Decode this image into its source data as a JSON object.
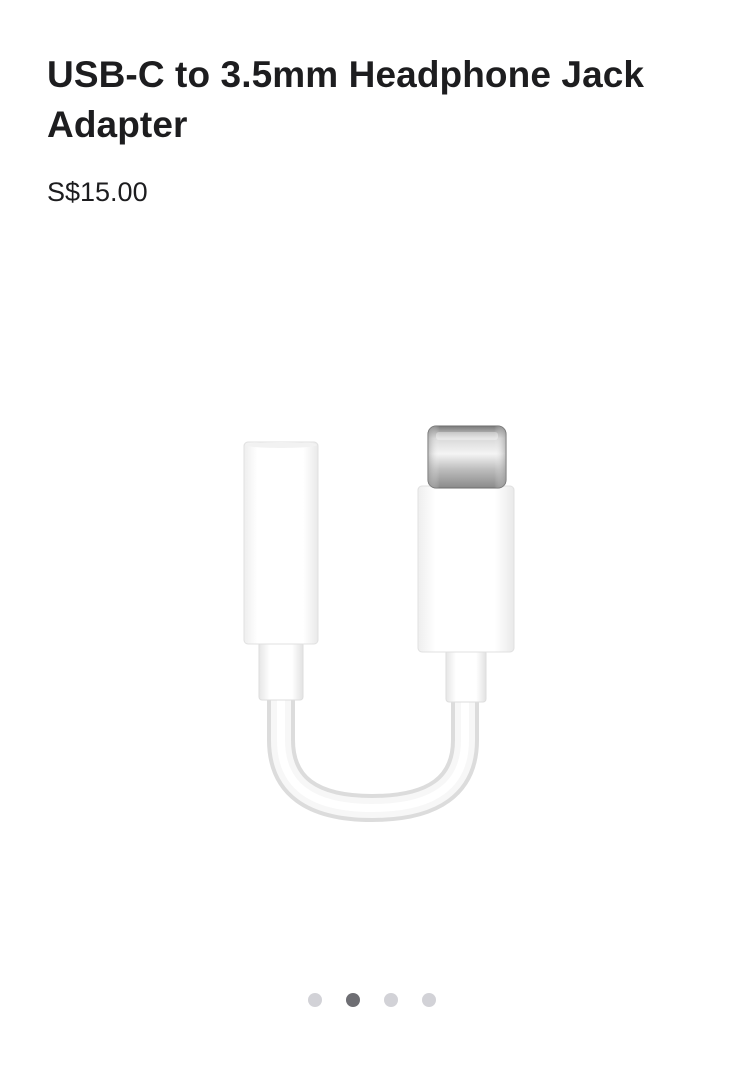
{
  "product": {
    "title": "USB-C to 3.5mm Headphone Jack Adapter",
    "price": "S$15.00"
  },
  "gallery": {
    "image_subject": "usb-c-to-3.5mm-adapter",
    "slide_count": 4,
    "active_slide": 2
  },
  "colors": {
    "text": "#1d1d1f",
    "dot_inactive": "#d2d2d7",
    "dot_active": "#6e6e73"
  }
}
